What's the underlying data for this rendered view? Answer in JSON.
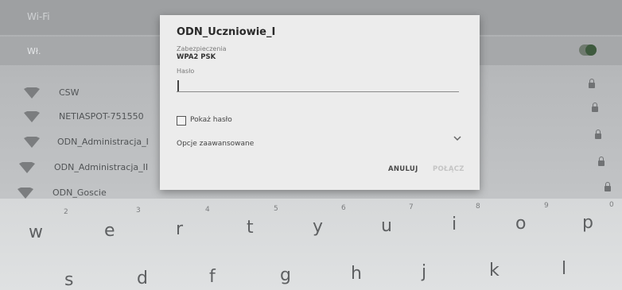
{
  "screen": {
    "title": "Wi-Fi",
    "wifi_label": "Wł.",
    "networks": [
      {
        "name": "CSW"
      },
      {
        "name": "NETIASPOT-751550"
      },
      {
        "name": "ODN_Administracja_I"
      },
      {
        "name": "ODN_Administracja_II"
      },
      {
        "name": "ODN_Goscie"
      }
    ]
  },
  "dialog": {
    "title": "ODN_Uczniowie_I",
    "security_label": "Zabezpieczenia",
    "security_value": "WPA2 PSK",
    "password_label": "Hasło",
    "password_value": "",
    "show_password_label": "Pokaż hasło",
    "show_password_checked": false,
    "advanced_label": "Opcje zaawansowane",
    "cancel_label": "ANULUJ",
    "connect_label": "POŁĄCZ"
  },
  "keyboard": {
    "row1": [
      {
        "key": "w",
        "hint": ""
      },
      {
        "key": "e",
        "hint": "2"
      },
      {
        "key": "r",
        "hint": "3"
      },
      {
        "key": "t",
        "hint": "4"
      },
      {
        "key": "y",
        "hint": "5"
      },
      {
        "key": "u",
        "hint": "6"
      },
      {
        "key": "i",
        "hint": "7"
      },
      {
        "key": "o",
        "hint": "8"
      },
      {
        "key": "p",
        "hint": "9"
      },
      {
        "key": "",
        "hint": "0"
      }
    ],
    "row2": [
      "s",
      "d",
      "f",
      "g",
      "h",
      "j",
      "k",
      "l"
    ]
  },
  "colors": {
    "accent": "#3e5a3e",
    "dialog_bg": "#ececec"
  }
}
